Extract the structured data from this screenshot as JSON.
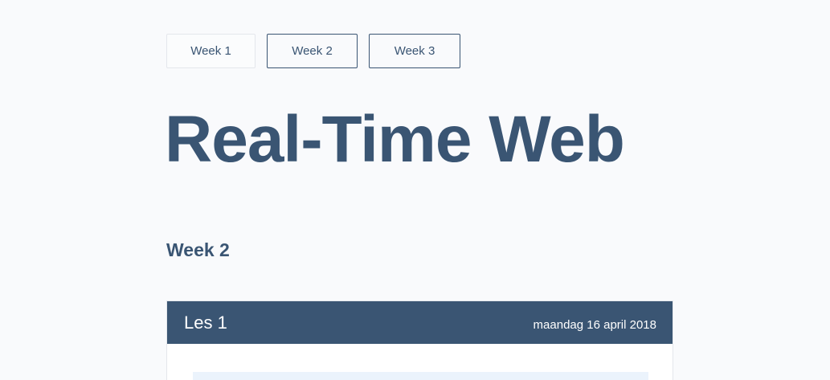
{
  "nav": {
    "tabs": [
      {
        "label": "Week 1"
      },
      {
        "label": "Week 2"
      },
      {
        "label": "Week 3"
      }
    ]
  },
  "page": {
    "title": "Real-Time Web",
    "section_heading": "Week 2"
  },
  "lesson": {
    "title": "Les 1",
    "date": "maandag 16 april 2018"
  },
  "colors": {
    "primary": "#3a5573",
    "background": "#f9fafc",
    "code_block": "#ebf3fc"
  }
}
